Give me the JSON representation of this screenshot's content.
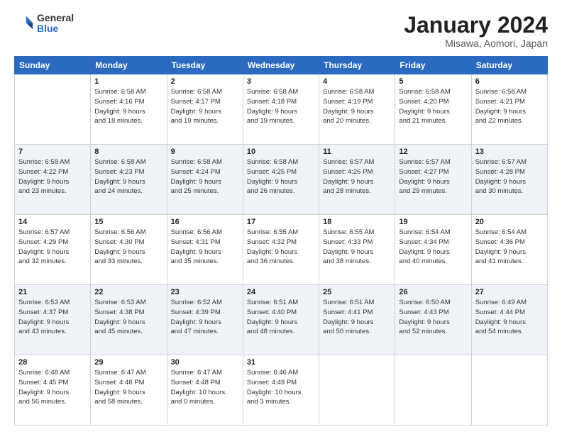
{
  "logo": {
    "general": "General",
    "blue": "Blue"
  },
  "header": {
    "title": "January 2024",
    "subtitle": "Misawa, Aomori, Japan"
  },
  "columns": [
    "Sunday",
    "Monday",
    "Tuesday",
    "Wednesday",
    "Thursday",
    "Friday",
    "Saturday"
  ],
  "weeks": [
    [
      {
        "day": "",
        "info": ""
      },
      {
        "day": "1",
        "info": "Sunrise: 6:58 AM\nSunset: 4:16 PM\nDaylight: 9 hours\nand 18 minutes."
      },
      {
        "day": "2",
        "info": "Sunrise: 6:58 AM\nSunset: 4:17 PM\nDaylight: 9 hours\nand 19 minutes."
      },
      {
        "day": "3",
        "info": "Sunrise: 6:58 AM\nSunset: 4:18 PM\nDaylight: 9 hours\nand 19 minutes."
      },
      {
        "day": "4",
        "info": "Sunrise: 6:58 AM\nSunset: 4:19 PM\nDaylight: 9 hours\nand 20 minutes."
      },
      {
        "day": "5",
        "info": "Sunrise: 6:58 AM\nSunset: 4:20 PM\nDaylight: 9 hours\nand 21 minutes."
      },
      {
        "day": "6",
        "info": "Sunrise: 6:58 AM\nSunset: 4:21 PM\nDaylight: 9 hours\nand 22 minutes."
      }
    ],
    [
      {
        "day": "7",
        "info": "Sunrise: 6:58 AM\nSunset: 4:22 PM\nDaylight: 9 hours\nand 23 minutes."
      },
      {
        "day": "8",
        "info": "Sunrise: 6:58 AM\nSunset: 4:23 PM\nDaylight: 9 hours\nand 24 minutes."
      },
      {
        "day": "9",
        "info": "Sunrise: 6:58 AM\nSunset: 4:24 PM\nDaylight: 9 hours\nand 25 minutes."
      },
      {
        "day": "10",
        "info": "Sunrise: 6:58 AM\nSunset: 4:25 PM\nDaylight: 9 hours\nand 26 minutes."
      },
      {
        "day": "11",
        "info": "Sunrise: 6:57 AM\nSunset: 4:26 PM\nDaylight: 9 hours\nand 28 minutes."
      },
      {
        "day": "12",
        "info": "Sunrise: 6:57 AM\nSunset: 4:27 PM\nDaylight: 9 hours\nand 29 minutes."
      },
      {
        "day": "13",
        "info": "Sunrise: 6:57 AM\nSunset: 4:28 PM\nDaylight: 9 hours\nand 30 minutes."
      }
    ],
    [
      {
        "day": "14",
        "info": "Sunrise: 6:57 AM\nSunset: 4:29 PM\nDaylight: 9 hours\nand 32 minutes."
      },
      {
        "day": "15",
        "info": "Sunrise: 6:56 AM\nSunset: 4:30 PM\nDaylight: 9 hours\nand 33 minutes."
      },
      {
        "day": "16",
        "info": "Sunrise: 6:56 AM\nSunset: 4:31 PM\nDaylight: 9 hours\nand 35 minutes."
      },
      {
        "day": "17",
        "info": "Sunrise: 6:55 AM\nSunset: 4:32 PM\nDaylight: 9 hours\nand 36 minutes."
      },
      {
        "day": "18",
        "info": "Sunrise: 6:55 AM\nSunset: 4:33 PM\nDaylight: 9 hours\nand 38 minutes."
      },
      {
        "day": "19",
        "info": "Sunrise: 6:54 AM\nSunset: 4:34 PM\nDaylight: 9 hours\nand 40 minutes."
      },
      {
        "day": "20",
        "info": "Sunrise: 6:54 AM\nSunset: 4:36 PM\nDaylight: 9 hours\nand 41 minutes."
      }
    ],
    [
      {
        "day": "21",
        "info": "Sunrise: 6:53 AM\nSunset: 4:37 PM\nDaylight: 9 hours\nand 43 minutes."
      },
      {
        "day": "22",
        "info": "Sunrise: 6:53 AM\nSunset: 4:38 PM\nDaylight: 9 hours\nand 45 minutes."
      },
      {
        "day": "23",
        "info": "Sunrise: 6:52 AM\nSunset: 4:39 PM\nDaylight: 9 hours\nand 47 minutes."
      },
      {
        "day": "24",
        "info": "Sunrise: 6:51 AM\nSunset: 4:40 PM\nDaylight: 9 hours\nand 48 minutes."
      },
      {
        "day": "25",
        "info": "Sunrise: 6:51 AM\nSunset: 4:41 PM\nDaylight: 9 hours\nand 50 minutes."
      },
      {
        "day": "26",
        "info": "Sunrise: 6:50 AM\nSunset: 4:43 PM\nDaylight: 9 hours\nand 52 minutes."
      },
      {
        "day": "27",
        "info": "Sunrise: 6:49 AM\nSunset: 4:44 PM\nDaylight: 9 hours\nand 54 minutes."
      }
    ],
    [
      {
        "day": "28",
        "info": "Sunrise: 6:48 AM\nSunset: 4:45 PM\nDaylight: 9 hours\nand 56 minutes."
      },
      {
        "day": "29",
        "info": "Sunrise: 6:47 AM\nSunset: 4:46 PM\nDaylight: 9 hours\nand 58 minutes."
      },
      {
        "day": "30",
        "info": "Sunrise: 6:47 AM\nSunset: 4:48 PM\nDaylight: 10 hours\nand 0 minutes."
      },
      {
        "day": "31",
        "info": "Sunrise: 6:46 AM\nSunset: 4:49 PM\nDaylight: 10 hours\nand 3 minutes."
      },
      {
        "day": "",
        "info": ""
      },
      {
        "day": "",
        "info": ""
      },
      {
        "day": "",
        "info": ""
      }
    ]
  ]
}
